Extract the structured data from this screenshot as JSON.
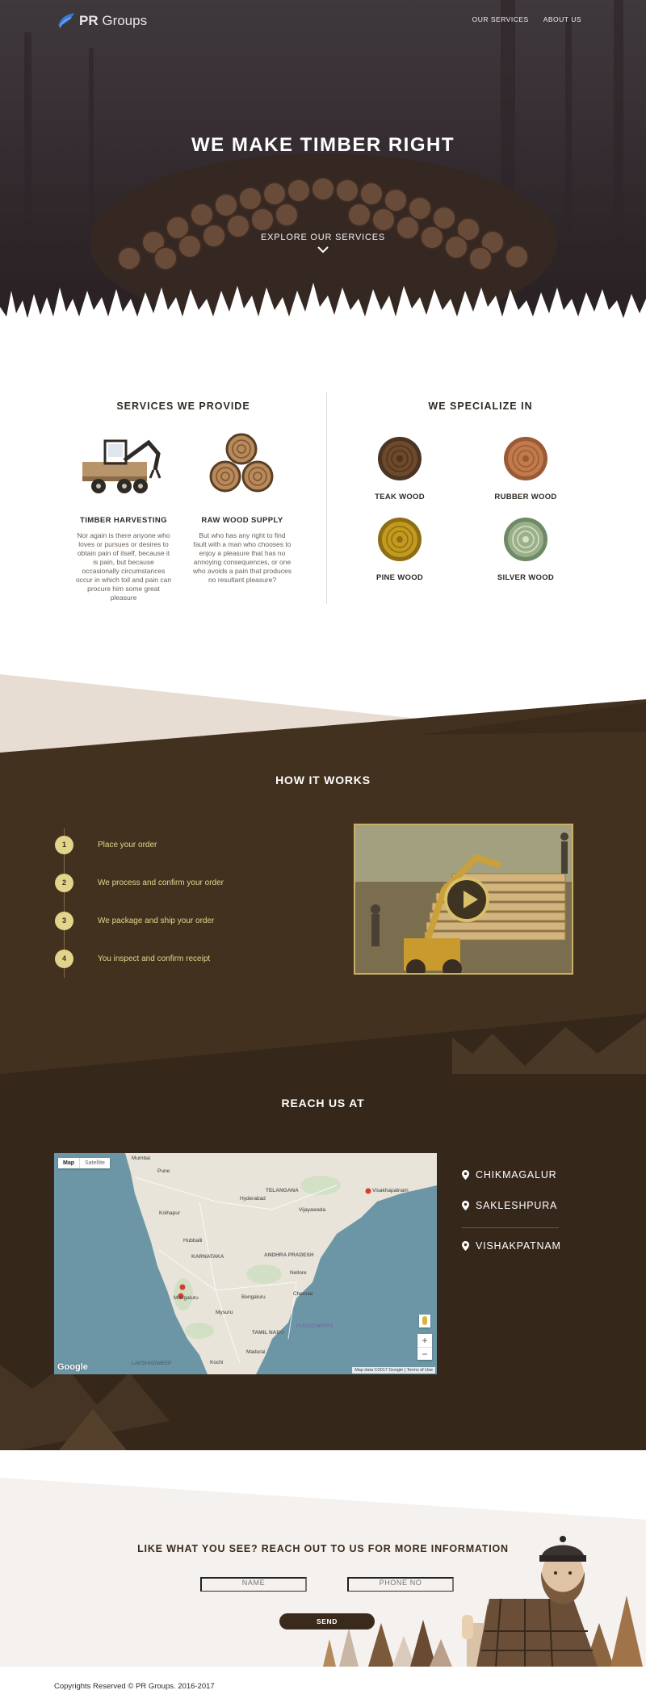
{
  "nav": {
    "logo_bold": "PR",
    "logo_rest": " Groups",
    "links": [
      "OUR SERVICES",
      "ABOUT US"
    ]
  },
  "hero": {
    "title": "WE MAKE TIMBER RIGHT",
    "explore": "EXPLORE OUR SERVICES"
  },
  "services": {
    "title": "SERVICES WE PROVIDE",
    "items": [
      {
        "name": "TIMBER HARVESTING",
        "text": "Nor again is there anyone who loves or pursues or desires to obtain pain of itself, because it is pain, but because occasionally circumstances occur in which toil and pain can procure him some great pleasure"
      },
      {
        "name": "RAW WOOD SUPPLY",
        "text": "But who has any right to find fault with a man who chooses to enjoy a pleasure that has no annoying consequences, or one who avoids a pain that produces no resultant pleasure?"
      }
    ]
  },
  "specialize": {
    "title": "WE SPECIALIZE IN",
    "woods": [
      {
        "name": "TEAK WOOD",
        "color": "#6e4a2a"
      },
      {
        "name": "RUBBER WOOD",
        "color": "#c07a4c"
      },
      {
        "name": "PINE WOOD",
        "color": "#c29a1e"
      },
      {
        "name": "SILVER WOOD",
        "color": "#9ab08a"
      }
    ]
  },
  "how": {
    "title": "HOW IT WORKS",
    "steps": [
      {
        "num": "1",
        "label": "Place your order"
      },
      {
        "num": "2",
        "label": "We process and confirm your order"
      },
      {
        "num": "3",
        "label": "We package and ship your order"
      },
      {
        "num": "4",
        "label": "You inspect and confirm receipt"
      }
    ]
  },
  "reach": {
    "title": "REACH US AT",
    "map": {
      "type_map": "Map",
      "type_satellite": "Satellite",
      "google": "Google",
      "terms": "Map data ©2017 Google | Terms of Use",
      "zoom_in": "+",
      "zoom_out": "−",
      "labels": [
        "Mumbai",
        "Pune",
        "TELANGANA",
        "Vijayawada",
        "Kolhapur",
        "Hubballi",
        "KARNATAKA",
        "ANDHRA PRADESH",
        "Bengaluru",
        "Chennai",
        "Nellore",
        "Mangaluru",
        "Mysuru",
        "TAMIL NADU",
        "Madurai",
        "PUDUCHERRY",
        "LAKSHADWEEP",
        "Visakhapatnam",
        "Kochi",
        "Hyderabad"
      ]
    },
    "locations": [
      "CHIKMAGALUR",
      "SAKLESHPURA",
      "VISHAKPATNAM"
    ]
  },
  "contact": {
    "title": "LIKE WHAT YOU SEE? REACH OUT TO US FOR MORE INFORMATION",
    "name_placeholder": "NAME",
    "phone_placeholder": "PHONE NO",
    "send": "SEND"
  },
  "footer": {
    "copyright": "Copyrights Reserved © PR Groups. 2016-2017"
  }
}
